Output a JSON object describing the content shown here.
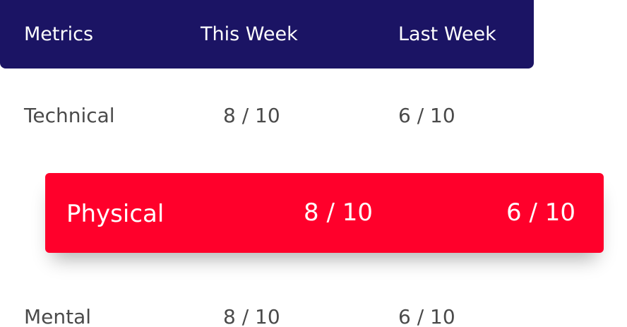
{
  "header": {
    "metrics_label": "Metrics",
    "this_week_label": "This Week",
    "last_week_label": "Last Week"
  },
  "rows": [
    {
      "metric": "Technical",
      "this_week": "8 / 10",
      "last_week": "6 / 10",
      "highlighted": false
    },
    {
      "metric": "Physical",
      "this_week": "8 / 10",
      "last_week": "6 / 10",
      "highlighted": true
    },
    {
      "metric": "Mental",
      "this_week": "8 / 10",
      "last_week": "6 / 10",
      "highlighted": false
    }
  ],
  "colors": {
    "header_background": "#1b1464",
    "highlight_background": "#ff002b",
    "row_text": "#4a4a4a",
    "header_text": "#ffffff"
  }
}
